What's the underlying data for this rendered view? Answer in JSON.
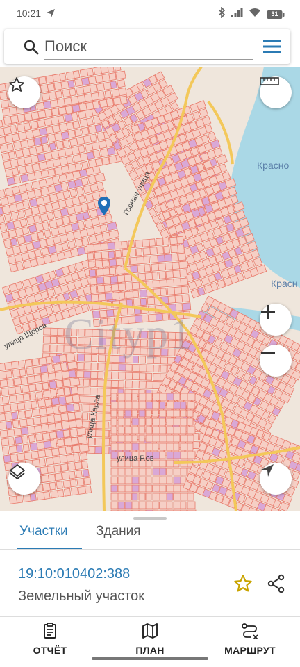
{
  "status_bar": {
    "time": "10:21",
    "battery": "31"
  },
  "search": {
    "placeholder": "Поиск"
  },
  "map": {
    "labels": {
      "river_1": "Красно",
      "river_2": "Красн",
      "street_gornaya": "Горная улица",
      "street_shchorsa": "улица Щорса",
      "street_vertical": "улица Карла",
      "street_bottom": "улица Р.ов",
      "watermark": "Сityp1"
    },
    "colors": {
      "background": "#efe6dc",
      "parcel_stroke": "#e8796a",
      "parcel_fill": "#f6cfc5",
      "river": "#aad8e6",
      "road": "#f3c85a",
      "marker": "#1f6fb7"
    }
  },
  "tabs": [
    {
      "label": "Участки",
      "active": true
    },
    {
      "label": "Здания",
      "active": false
    }
  ],
  "parcel": {
    "cadastral_number": "19:10:010402:388",
    "type": "Земельный участок"
  },
  "actions": [
    {
      "label": "ОТЧЁТ",
      "icon": "clipboard-icon"
    },
    {
      "label": "ПЛАН",
      "icon": "map-icon"
    },
    {
      "label": "МАРШРУТ",
      "icon": "route-icon"
    }
  ]
}
